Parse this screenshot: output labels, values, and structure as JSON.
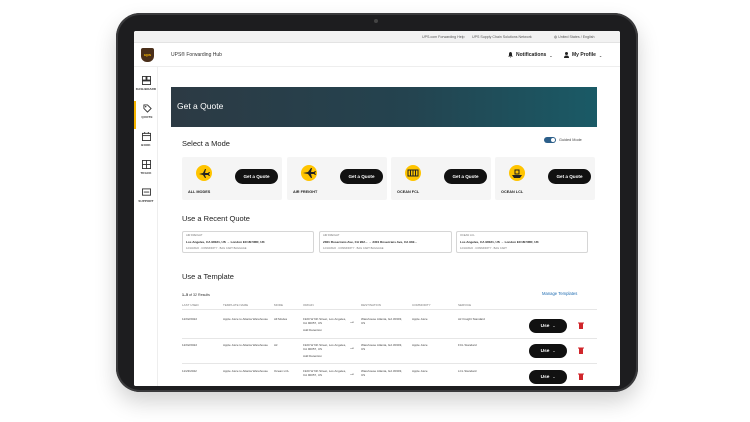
{
  "utility_bar": {
    "items": [
      "UPS.com Forwarding Help",
      "UPS Supply Chain Solutions Network",
      "United States / English"
    ]
  },
  "header": {
    "logo_text": "ups",
    "app_title": "UPS® Forwarding Hub",
    "notifications_label": "Notifications",
    "profile_label": "My Profile"
  },
  "sidebar": {
    "items": [
      {
        "label": "DASHBOARD",
        "icon": "dashboard-icon"
      },
      {
        "label": "QUOTE",
        "icon": "tag-icon"
      },
      {
        "label": "BOOK",
        "icon": "calendar-icon"
      },
      {
        "label": "TRACK",
        "icon": "box-icon"
      },
      {
        "label": "SUPPORT",
        "icon": "support-icon"
      }
    ]
  },
  "hero": {
    "title": "Get a Quote"
  },
  "modes": {
    "title": "Select a Mode",
    "toggle_label": "Guided Mode",
    "button_label": "Get a Quote",
    "cards": [
      {
        "label": "ALL MODES"
      },
      {
        "label": "AIR FREIGHT"
      },
      {
        "label": "OCEAN FCL"
      },
      {
        "label": "OCEAN LCL"
      }
    ]
  },
  "recent": {
    "title": "Use a Recent Quote",
    "cards": [
      {
        "type": "AIR FREIGHT",
        "route": "Los Angeles, CA 90021, US → London EC1M 5RR, UK",
        "meta": "12/13/2022 · COMMODITY · BAG CART BAGGAGE"
      },
      {
        "type": "AIR FREIGHT",
        "route": "2301 Rosecrans Ave, CA 902... → 2301 Rosecrans Ave, CA 902...",
        "meta": "12/13/2022 · COMMODITY · BAG CART BAGGAGE"
      },
      {
        "type": "OCEAN LCL",
        "route": "Los Angeles, CA 90021, US → London EC1M 5RR, UK",
        "meta": "12/13/2022 · COMMODITY · BAG CART"
      }
    ]
  },
  "templates": {
    "title": "Use a Template",
    "results_prefix": "1–5",
    "results_suffix": "of 32 Results",
    "manage_link": "Manage Templates",
    "use_label": "Use",
    "headers": [
      "LAST USED",
      "TEMPLATE NAME",
      "MODE",
      "ORIGIN",
      "DESTINATION",
      "COMMODITY",
      "SERVICE"
    ],
    "rows": [
      {
        "last_used": "12/02/2022",
        "name": "Apple Juice to Atlanta Warehouse",
        "mode": "All Modes",
        "origin": "1920 W 6th Street, Los Angeles, CA 90057, US",
        "origin_extra": "Add Detention",
        "destination": "Warehouse Atlanta, GA 30303, US",
        "commodity": "Apple Juice",
        "service": "Air Freight Standard"
      },
      {
        "last_used": "12/02/2022",
        "name": "Apple Juice to Atlanta Warehouse",
        "mode": "Air",
        "origin": "1920 W 6th Street, Los Angeles, CA 90057, US",
        "origin_extra": "Add Detention",
        "destination": "Warehouse Atlanta, GA 30303, US",
        "commodity": "Apple Juice",
        "service": "FCL Standard"
      },
      {
        "last_used": "11/23/2022",
        "name": "Apple Juice to Atlanta Warehouse",
        "mode": "Ocean LCL",
        "origin": "1920 W 6th Street, Los Angeles, CA 90057, US",
        "origin_extra": "",
        "destination": "Warehouse Atlanta, GA 30303, US",
        "commodity": "Apple Juice",
        "service": "LCL Standard"
      }
    ]
  },
  "colors": {
    "accent": "#ffc400",
    "ups_brown": "#4a2f1a",
    "link": "#1c6ab0",
    "delete": "#d0262b"
  }
}
